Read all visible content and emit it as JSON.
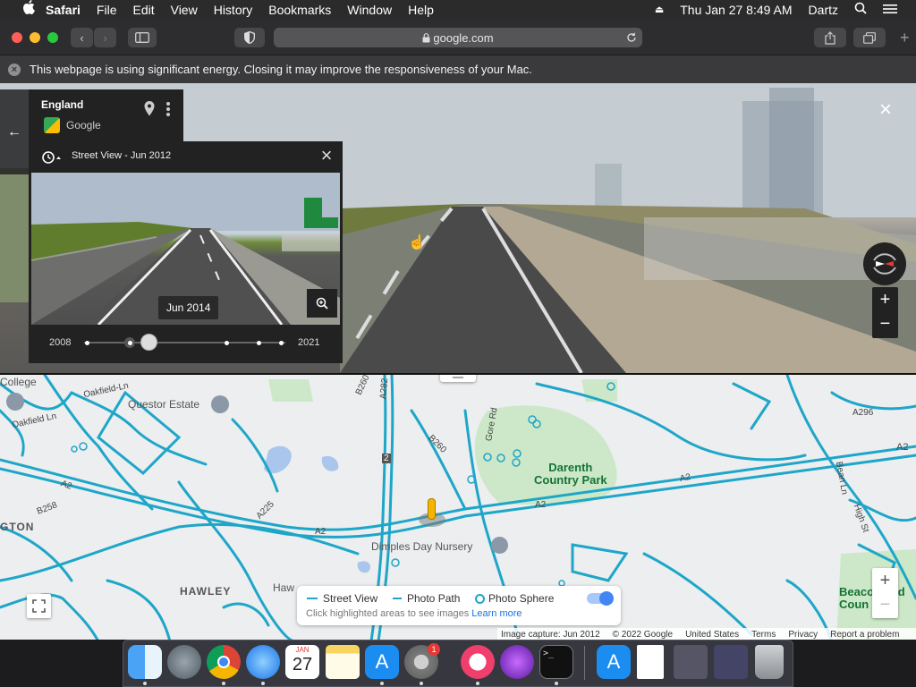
{
  "menubar": {
    "app_name": "Safari",
    "items": [
      "File",
      "Edit",
      "View",
      "History",
      "Bookmarks",
      "Window",
      "Help"
    ],
    "datetime": "Thu Jan 27  8:49 AM",
    "user": "Dartz"
  },
  "browser": {
    "url": "google.com"
  },
  "banner": {
    "message": "This webpage is using significant energy. Closing it may improve the responsiveness of your Mac."
  },
  "location_card": {
    "title": "England",
    "source": "Google"
  },
  "time_machine": {
    "header": "Street View - Jun 2012",
    "selected_date": "Jun 2014",
    "start_year": "2008",
    "end_year": "2021",
    "selected_position": 0.32
  },
  "map": {
    "places": [
      "Questor Estate",
      "Dimples Day Nursery",
      "HAWLEY",
      "GTON",
      "College",
      "Haw"
    ],
    "park": "Darenth\nCountry Park",
    "park_right": "Beaco   ood\nCoun",
    "roads": [
      "Oakfield-Ln",
      "Oakfield Ln",
      "A2",
      "A2",
      "A2",
      "A2",
      "A282",
      "B260",
      "B260",
      "A225",
      "B258",
      "Gore Rd",
      "Bean Ln",
      "High St",
      "A296",
      "2"
    ]
  },
  "legend": {
    "street_view": "Street View",
    "photo_path": "Photo Path",
    "photo_sphere": "Photo Sphere",
    "hint": "Click highlighted areas to see images",
    "learn_more": "Learn more"
  },
  "footer": {
    "capture": "Image capture: Jun 2012",
    "copyright": "© 2022 Google",
    "country": "United States",
    "terms": "Terms",
    "privacy": "Privacy",
    "report": "Report a problem"
  },
  "dock": {
    "calendar_month": "JAN",
    "calendar_day": "27",
    "badge": "1"
  },
  "colors": {
    "street_view_line": "#1ea6c9",
    "park_green": "#cde8c8",
    "toggle_blue": "#4285f4"
  }
}
